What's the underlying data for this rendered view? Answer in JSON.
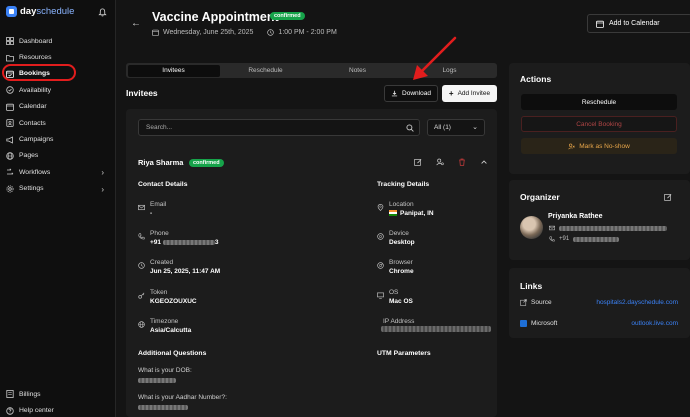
{
  "app": {
    "logo_word_a": "day",
    "logo_word_b": "schedule"
  },
  "sidebar": {
    "items": [
      {
        "label": "Dashboard",
        "icon": "dashboard-icon"
      },
      {
        "label": "Resources",
        "icon": "folder-icon"
      },
      {
        "label": "Bookings",
        "icon": "calendar-check-icon"
      },
      {
        "label": "Availability",
        "icon": "availability-icon"
      },
      {
        "label": "Calendar",
        "icon": "calendar-icon"
      },
      {
        "label": "Contacts",
        "icon": "contacts-icon"
      },
      {
        "label": "Campaigns",
        "icon": "campaigns-icon"
      },
      {
        "label": "Pages",
        "icon": "globe-icon"
      },
      {
        "label": "Workflows",
        "icon": "workflow-icon"
      },
      {
        "label": "Settings",
        "icon": "gear-icon"
      }
    ],
    "bottom": [
      {
        "label": "Billings"
      },
      {
        "label": "Help center"
      }
    ]
  },
  "header": {
    "title": "Vaccine Appointment",
    "status": "confirmed",
    "date": "Wednesday, June 25th, 2025",
    "time": "1:00 PM - 2:00 PM",
    "add_to_calendar": "Add to Calendar"
  },
  "tabs": [
    "Invitees",
    "Reschedule",
    "Notes",
    "Logs"
  ],
  "invitees": {
    "title": "Invitees",
    "download": "Download",
    "add_invitee": "Add Invitee",
    "search_placeholder": "Search...",
    "filter": "All (1)",
    "person": {
      "name": "Riya Sharma",
      "status": "confirmed",
      "contact_heading": "Contact Details",
      "tracking_heading": "Tracking Details",
      "email_label": "Email",
      "email_value": "-",
      "phone_label": "Phone",
      "phone_prefix": "+91",
      "phone_suffix": "3",
      "created_label": "Created",
      "created_value": "Jun 25, 2025, 11:47 AM",
      "token_label": "Token",
      "token_value": "KGEOZOUXUC",
      "timezone_label": "Timezone",
      "timezone_value": "Asia/Calcutta",
      "location_label": "Location",
      "location_value": "Panipat, IN",
      "device_label": "Device",
      "device_value": "Desktop",
      "browser_label": "Browser",
      "browser_value": "Chrome",
      "os_label": "OS",
      "os_value": "Mac OS",
      "ip_label": "IP Address",
      "questions_heading": "Additional Questions",
      "utm_heading": "UTM Parameters",
      "q1": "What is your DOB:",
      "q2": "What is your Aadhar Number?:"
    }
  },
  "actions": {
    "title": "Actions",
    "reschedule": "Reschedule",
    "cancel": "Cancel Booking",
    "no_show": "Mark as No-show"
  },
  "organizer": {
    "title": "Organizer",
    "name": "Priyanka Rathee",
    "phone_prefix": "+91"
  },
  "links": {
    "title": "Links",
    "source_label": "Source",
    "source_value": "hospitals2.dayschedule.com",
    "ms_label": "Microsoft",
    "ms_value": "outlook.live.com"
  },
  "colors": {
    "accent": "#3b82f6",
    "confirmed": "#16a34a",
    "highlight": "#e21d1d",
    "danger": "#b04545",
    "warning": "#e8a64a"
  }
}
